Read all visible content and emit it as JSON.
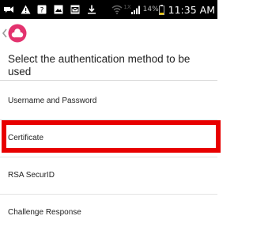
{
  "status_bar": {
    "network_type": "1X",
    "battery_percent": "14%",
    "time": "11:35 AM"
  },
  "header": {
    "title": "Select the authentication method to be used"
  },
  "methods": [
    {
      "label": "Username and Password"
    },
    {
      "label": "Certificate",
      "highlighted": true
    },
    {
      "label": "RSA SecurID"
    },
    {
      "label": "Challenge Response"
    }
  ],
  "colors": {
    "status_bar_bg": "#000000",
    "logo_pink": "#e3336f",
    "highlight_red": "#e80000"
  },
  "icons": {
    "status_left": [
      "notification-icon",
      "warning-icon",
      "unknown-app-icon",
      "image-icon",
      "mail-icon",
      "download-icon"
    ],
    "status_right": [
      "wifi-icon",
      "cellular-signal-icon",
      "battery-icon"
    ],
    "action_bar": [
      "back-chevron-icon",
      "app-logo-icon"
    ]
  }
}
